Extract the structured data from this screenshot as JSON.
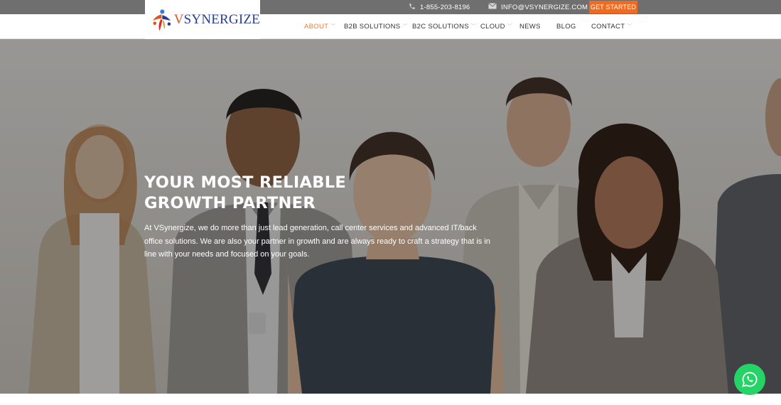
{
  "topbar": {
    "phone": "1-855-203-8196",
    "phone_icon": "phone-icon",
    "email": "INFO@VSYNERGIZE.COM",
    "email_icon": "envelope-icon",
    "cta_label": "GET STARTED"
  },
  "brand": {
    "logo_first": "V",
    "logo_rest": "SYNERGIZE"
  },
  "nav": {
    "items": [
      {
        "label": "ABOUT",
        "has_dropdown": true,
        "active": true
      },
      {
        "label": "B2B SOLUTIONS",
        "has_dropdown": true
      },
      {
        "label": "B2C SOLUTIONS",
        "has_dropdown": true
      },
      {
        "label": "CLOUD",
        "has_dropdown": true
      },
      {
        "label": "NEWS",
        "has_dropdown": false
      },
      {
        "label": "BLOG",
        "has_dropdown": false
      },
      {
        "label": "CONTACT",
        "has_dropdown": true
      }
    ]
  },
  "hero": {
    "headline_line1": "YOUR MOST RELIABLE",
    "headline_line2": "GROWTH PARTNER",
    "paragraph": "At VSynergize, we do more than just lead generation, call center services and advanced IT/back office solutions. We are also your partner in growth and are always ready to craft a strategy that is in line with your needs and focused on your goals."
  },
  "floating": {
    "whatsapp_icon": "whatsapp-icon"
  },
  "colors": {
    "accent": "#f06b22",
    "topbar_bg": "#6f6f6f",
    "logo_blue": "#2a3f8f",
    "whatsapp_green": "#25d366"
  }
}
